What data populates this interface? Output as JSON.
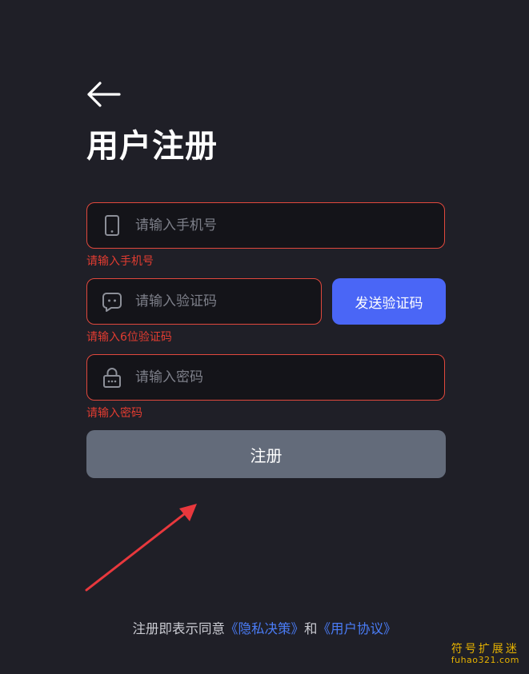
{
  "page": {
    "title": "用户注册"
  },
  "form": {
    "phone": {
      "placeholder": "请输入手机号",
      "value": "",
      "error": "请输入手机号",
      "icon": "smartphone-icon"
    },
    "code": {
      "placeholder": "请输入验证码",
      "value": "",
      "error": "请输入6位验证码",
      "icon": "message-icon",
      "send_button_label": "发送验证码"
    },
    "password": {
      "placeholder": "请输入密码",
      "value": "",
      "error": "请输入密码",
      "icon": "lock-icon"
    },
    "submit_label": "注册"
  },
  "agreement": {
    "prefix": "注册即表示同意",
    "privacy_link": "《隐私决策》",
    "conjunction": "和",
    "terms_link": "《用户协议》"
  },
  "watermark": {
    "title": "符号扩展迷",
    "url": "fuhao321.com"
  },
  "colors": {
    "background": "#1f1f27",
    "field_background": "#141419",
    "error": "#e23c31",
    "primary": "#4a66f6",
    "submit_disabled": "#636b7a",
    "link": "#4a7cf6",
    "annotation": "#e8383d",
    "watermark": "#e6b200"
  }
}
